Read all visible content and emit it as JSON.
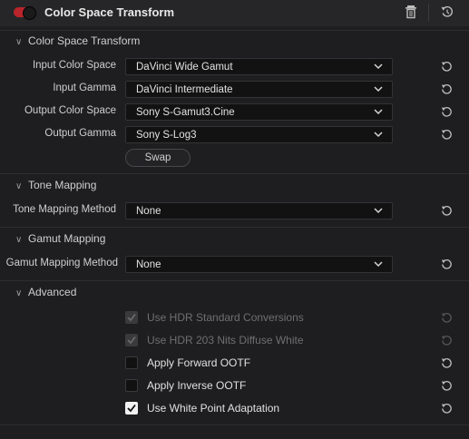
{
  "header": {
    "title": "Color Space Transform",
    "enabled": true,
    "accent_color": "#b8252b"
  },
  "csts": {
    "section_title": "Color Space Transform",
    "rows": [
      {
        "label": "Input Color Space",
        "value": "DaVinci Wide Gamut"
      },
      {
        "label": "Input Gamma",
        "value": "DaVinci Intermediate"
      },
      {
        "label": "Output Color Space",
        "value": "Sony S-Gamut3.Cine"
      },
      {
        "label": "Output Gamma",
        "value": "Sony S-Log3"
      }
    ],
    "swap_label": "Swap"
  },
  "tone": {
    "section_title": "Tone Mapping",
    "row": {
      "label": "Tone Mapping Method",
      "value": "None"
    }
  },
  "gamut": {
    "section_title": "Gamut Mapping",
    "row": {
      "label": "Gamut Mapping Method",
      "value": "None"
    }
  },
  "advanced": {
    "section_title": "Advanced",
    "options": [
      {
        "label": "Use HDR Standard Conversions",
        "checked": true,
        "enabled": false
      },
      {
        "label": "Use HDR 203 Nits Diffuse White",
        "checked": true,
        "enabled": false
      },
      {
        "label": "Apply Forward OOTF",
        "checked": false,
        "enabled": true
      },
      {
        "label": "Apply Inverse OOTF",
        "checked": false,
        "enabled": true
      },
      {
        "label": "Use White Point Adaptation",
        "checked": true,
        "enabled": true
      }
    ]
  },
  "icons": {
    "toggle": "power-toggle-icon",
    "trash": "trash-icon",
    "reset": "reset-icon",
    "chevron": "chevron-down-icon"
  }
}
